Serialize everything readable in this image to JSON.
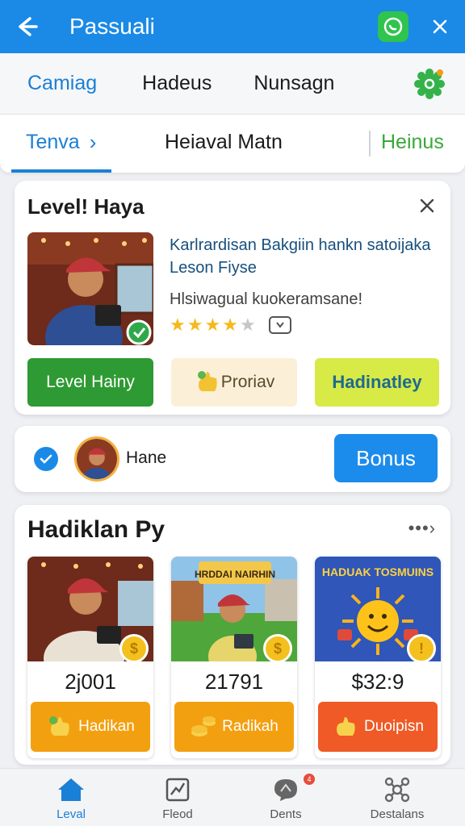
{
  "header": {
    "title": "Passuali",
    "back_icon": "arrow-left-icon",
    "whatsapp_icon": "whatsapp-icon",
    "close_icon": "close-icon"
  },
  "menu": {
    "items": [
      "Camiag",
      "Hadeus",
      "Nunsagn"
    ],
    "settings_icon": "gear-icon"
  },
  "tabs": {
    "active": "Tenva",
    "middle": "Heiaval Matn",
    "right": "Heinus"
  },
  "level_card": {
    "title": "Level! Haya",
    "headline": "Karlrardisan Bakgiin hankn satoijaka Leson Fiyse",
    "subline": "Hlsiwagual kuokeramsane!",
    "rating": 4,
    "rating_max": 5,
    "buttons": [
      "Level Hainy",
      "Proriav",
      "Hadinatley"
    ]
  },
  "user_row": {
    "name": "Hane",
    "bonus_label": "Bonus"
  },
  "section": {
    "title": "Hadiklan Py",
    "tiles": [
      {
        "value": "2j001",
        "button": "Hadikan",
        "coin": "$"
      },
      {
        "value": "21791",
        "button": "Radikah",
        "coin": "$",
        "banner": "HRDDAI NAIRHIN"
      },
      {
        "value": "$32:9",
        "button": "Duoipisn",
        "coin": "!",
        "banner": "HADUAK TOSMUINS"
      }
    ]
  },
  "bottom_nav": [
    {
      "label": "Leval",
      "icon": "home-icon",
      "active": true
    },
    {
      "label": "Fleod",
      "icon": "chart-icon",
      "active": false
    },
    {
      "label": "Dents",
      "icon": "chat-icon",
      "active": false,
      "badge": "4"
    },
    {
      "label": "Destalans",
      "icon": "network-icon",
      "active": false
    }
  ],
  "colors": {
    "primary": "#1a8ae6",
    "green": "#2e9a33",
    "orange": "#f3a010",
    "red": "#ef5a26",
    "lime": "#d7ea45"
  }
}
